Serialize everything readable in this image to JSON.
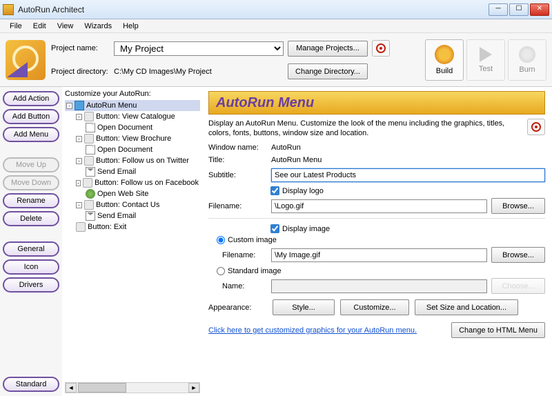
{
  "window": {
    "title": "AutoRun Architect"
  },
  "menu": {
    "file": "File",
    "edit": "Edit",
    "view": "View",
    "wizards": "Wizards",
    "help": "Help"
  },
  "toolbar": {
    "project_name_label": "Project name:",
    "project_name": "My Project",
    "project_dir_label": "Project directory:",
    "project_dir": "C:\\My CD Images\\My Project",
    "manage_projects": "Manage Projects...",
    "change_directory": "Change Directory...",
    "build": "Build",
    "test": "Test",
    "burn": "Burn"
  },
  "actions": {
    "add_action": "Add Action",
    "add_button": "Add Button",
    "add_menu": "Add Menu",
    "move_up": "Move Up",
    "move_down": "Move Down",
    "rename": "Rename",
    "delete": "Delete",
    "general": "General",
    "icon": "Icon",
    "drivers": "Drivers",
    "standard": "Standard"
  },
  "tree": {
    "title": "Customize your AutoRun:",
    "root": "AutoRun Menu",
    "b1": "Button: View Catalogue",
    "a1": "Open Document",
    "b2": "Button: View Brochure",
    "a2": "Open Document",
    "b3": "Button: Follow us on Twitter",
    "a3": "Send Email",
    "b4": "Button: Follow us on Facebook",
    "a4": "Open Web Site",
    "b5": "Button: Contact Us",
    "a5": "Send Email",
    "b6": "Button: Exit"
  },
  "panel": {
    "heading": "AutoRun Menu",
    "description": "Display an AutoRun Menu. Customize the look of the menu including the graphics, titles, colors, fonts, buttons, window size and location.",
    "window_name_label": "Window name:",
    "window_name": "AutoRun",
    "title_label": "Title:",
    "title_value": "AutoRun Menu",
    "subtitle_label": "Subtitle:",
    "subtitle_value": "See our Latest Products",
    "display_logo": "Display logo",
    "filename_label": "Filename:",
    "logo_filename": "\\Logo.gif",
    "browse": "Browse...",
    "display_image": "Display image",
    "custom_image": "Custom image",
    "image_filename": "\\My Image.gif",
    "standard_image": "Standard image",
    "name_label": "Name:",
    "choose": "Choose...",
    "appearance_label": "Appearance:",
    "style": "Style...",
    "customize": "Customize...",
    "set_size": "Set Size and Location...",
    "custom_link": "Click here to get customized graphics for your AutoRun menu.",
    "change_html": "Change to HTML Menu"
  }
}
